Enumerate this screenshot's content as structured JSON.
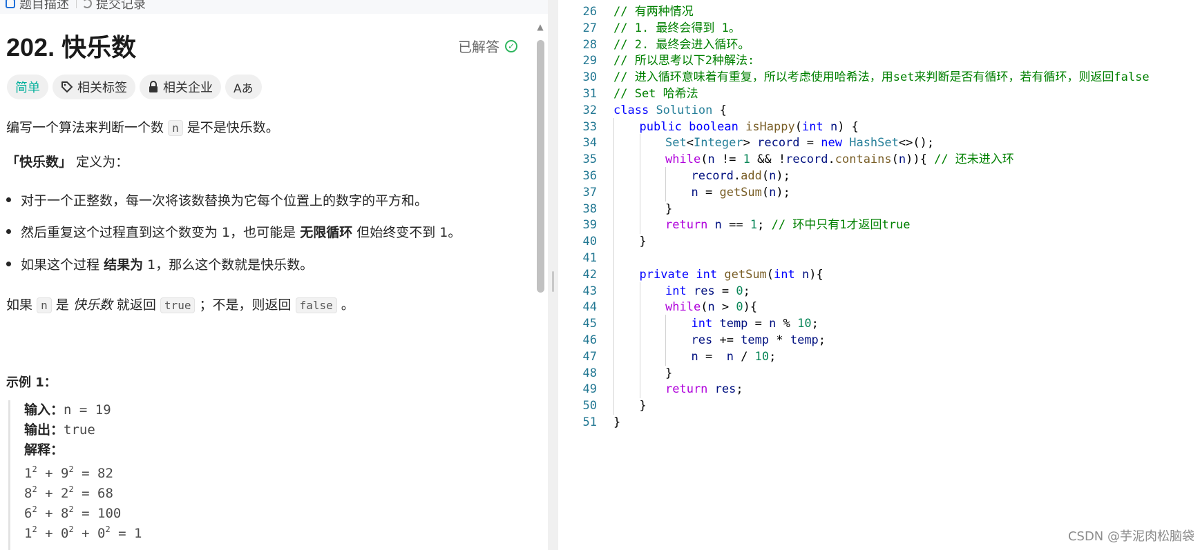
{
  "tabs": {
    "description": "题目描述",
    "submissions": "提交记录"
  },
  "problem": {
    "title": "202. 快乐数",
    "status": "已解答",
    "tags": {
      "difficulty": "简单",
      "topics": "相关标签",
      "companies": "相关企业",
      "translate_glyph": "Aあ"
    },
    "desc": {
      "p1_a": "编写一个算法来判断一个数",
      "p1_code": "n",
      "p1_b": "是不是快乐数。",
      "p2_bold": "「快乐数」",
      "p2_rest": "定义为：",
      "b1": "对于一个正整数，每一次将该数替换为它每个位置上的数字的平方和。",
      "b2_a": "然后重复这个过程直到这个数变为 1，也可能是",
      "b2_bold": "无限循环",
      "b2_b": "但始终变不到 1。",
      "b3_a": "如果这个过程",
      "b3_bold": "结果为",
      "b3_b": "1，那么这个数就是快乐数。",
      "p3_a": "如果",
      "p3_code1": "n",
      "p3_b": "是",
      "p3_em": "快乐数",
      "p3_c": "就返回",
      "p3_code2": "true",
      "p3_d": "；不是，则返回",
      "p3_code3": "false",
      "p3_e": "。"
    },
    "example": {
      "title": "示例 1：",
      "input_label": "输入：",
      "input_value": "n = 19",
      "output_label": "输出：",
      "output_value": "true",
      "explain_label": "解释：",
      "lines": [
        {
          "t1": "1",
          "t2": "9",
          "rest": " = 82"
        },
        {
          "t1": "8",
          "t2": "2",
          "rest": " = 68"
        },
        {
          "t1": "6",
          "t2": "8",
          "rest": " = 100"
        }
      ],
      "last": {
        "t1": "1",
        "t2": "0",
        "t3": "0",
        "rest": " = 1"
      },
      "exp": "2",
      "plus": " + "
    }
  },
  "code": {
    "lines": [
      {
        "n": "26",
        "indent": 0,
        "tokens": [
          [
            "cm",
            "// 有两种情况"
          ]
        ]
      },
      {
        "n": "27",
        "indent": 0,
        "tokens": [
          [
            "cm",
            "// 1. 最终会得到 1。"
          ]
        ]
      },
      {
        "n": "28",
        "indent": 0,
        "tokens": [
          [
            "cm",
            "// 2. 最终会进入循环。"
          ]
        ]
      },
      {
        "n": "29",
        "indent": 0,
        "tokens": [
          [
            "cm",
            "// 所以思考以下2种解法:"
          ]
        ]
      },
      {
        "n": "30",
        "indent": 0,
        "tokens": [
          [
            "cm",
            "// 进入循环意味着有重复，所以考虑使用哈希法，用set来判断是否有循环，若有循环，则返回false"
          ]
        ]
      },
      {
        "n": "31",
        "indent": 0,
        "tokens": [
          [
            "cm",
            "// Set 哈希法"
          ]
        ]
      },
      {
        "n": "32",
        "indent": 0,
        "tokens": [
          [
            "kw",
            "class"
          ],
          [
            "pl",
            " "
          ],
          [
            "ty",
            "Solution"
          ],
          [
            "pl",
            " {"
          ]
        ]
      },
      {
        "n": "33",
        "indent": 1,
        "tokens": [
          [
            "kw",
            "public"
          ],
          [
            "pl",
            " "
          ],
          [
            "kw",
            "boolean"
          ],
          [
            "pl",
            " "
          ],
          [
            "fn",
            "isHappy"
          ],
          [
            "pl",
            "("
          ],
          [
            "kw",
            "int"
          ],
          [
            "pl",
            " "
          ],
          [
            "vr",
            "n"
          ],
          [
            "pl",
            ") {"
          ]
        ]
      },
      {
        "n": "34",
        "indent": 2,
        "tokens": [
          [
            "ty",
            "Set"
          ],
          [
            "pl",
            "<"
          ],
          [
            "ty",
            "Integer"
          ],
          [
            "pl",
            "> "
          ],
          [
            "vr",
            "record"
          ],
          [
            "pl",
            " = "
          ],
          [
            "kw",
            "new"
          ],
          [
            "pl",
            " "
          ],
          [
            "ty",
            "HashSet"
          ],
          [
            "pl",
            "<>();"
          ]
        ]
      },
      {
        "n": "35",
        "indent": 2,
        "tokens": [
          [
            "kw2",
            "while"
          ],
          [
            "pl",
            "("
          ],
          [
            "vr",
            "n"
          ],
          [
            "pl",
            " != "
          ],
          [
            "nm",
            "1"
          ],
          [
            "pl",
            " && !"
          ],
          [
            "vr",
            "record"
          ],
          [
            "pl",
            "."
          ],
          [
            "fn",
            "contains"
          ],
          [
            "pl",
            "("
          ],
          [
            "vr",
            "n"
          ],
          [
            "pl",
            ")){ "
          ],
          [
            "cm",
            "// 还未进入环"
          ]
        ]
      },
      {
        "n": "36",
        "indent": 3,
        "tokens": [
          [
            "vr",
            "record"
          ],
          [
            "pl",
            "."
          ],
          [
            "fn",
            "add"
          ],
          [
            "pl",
            "("
          ],
          [
            "vr",
            "n"
          ],
          [
            "pl",
            ");"
          ]
        ]
      },
      {
        "n": "37",
        "indent": 3,
        "tokens": [
          [
            "vr",
            "n"
          ],
          [
            "pl",
            " = "
          ],
          [
            "fn",
            "getSum"
          ],
          [
            "pl",
            "("
          ],
          [
            "vr",
            "n"
          ],
          [
            "pl",
            ");"
          ]
        ]
      },
      {
        "n": "38",
        "indent": 2,
        "tokens": [
          [
            "pl",
            "}"
          ]
        ]
      },
      {
        "n": "39",
        "indent": 2,
        "tokens": [
          [
            "kw2",
            "return"
          ],
          [
            "pl",
            " "
          ],
          [
            "vr",
            "n"
          ],
          [
            "pl",
            " == "
          ],
          [
            "nm",
            "1"
          ],
          [
            "pl",
            "; "
          ],
          [
            "cm",
            "// 环中只有1才返回true"
          ]
        ]
      },
      {
        "n": "40",
        "indent": 1,
        "tokens": [
          [
            "pl",
            "}"
          ]
        ]
      },
      {
        "n": "41",
        "indent": 1,
        "tokens": []
      },
      {
        "n": "42",
        "indent": 1,
        "tokens": [
          [
            "kw",
            "private"
          ],
          [
            "pl",
            " "
          ],
          [
            "kw",
            "int"
          ],
          [
            "pl",
            " "
          ],
          [
            "fn",
            "getSum"
          ],
          [
            "pl",
            "("
          ],
          [
            "kw",
            "int"
          ],
          [
            "pl",
            " "
          ],
          [
            "vr",
            "n"
          ],
          [
            "pl",
            "){"
          ]
        ]
      },
      {
        "n": "43",
        "indent": 2,
        "tokens": [
          [
            "kw",
            "int"
          ],
          [
            "pl",
            " "
          ],
          [
            "vr",
            "res"
          ],
          [
            "pl",
            " = "
          ],
          [
            "nm",
            "0"
          ],
          [
            "pl",
            ";"
          ]
        ]
      },
      {
        "n": "44",
        "indent": 2,
        "tokens": [
          [
            "kw2",
            "while"
          ],
          [
            "pl",
            "("
          ],
          [
            "vr",
            "n"
          ],
          [
            "pl",
            " > "
          ],
          [
            "nm",
            "0"
          ],
          [
            "pl",
            "){"
          ]
        ]
      },
      {
        "n": "45",
        "indent": 3,
        "tokens": [
          [
            "kw",
            "int"
          ],
          [
            "pl",
            " "
          ],
          [
            "vr",
            "temp"
          ],
          [
            "pl",
            " = "
          ],
          [
            "vr",
            "n"
          ],
          [
            "pl",
            " % "
          ],
          [
            "nm",
            "10"
          ],
          [
            "pl",
            ";"
          ]
        ]
      },
      {
        "n": "46",
        "indent": 3,
        "tokens": [
          [
            "vr",
            "res"
          ],
          [
            "pl",
            " += "
          ],
          [
            "vr",
            "temp"
          ],
          [
            "pl",
            " * "
          ],
          [
            "vr",
            "temp"
          ],
          [
            "pl",
            ";"
          ]
        ]
      },
      {
        "n": "47",
        "indent": 3,
        "tokens": [
          [
            "vr",
            "n"
          ],
          [
            "pl",
            " =  "
          ],
          [
            "vr",
            "n"
          ],
          [
            "pl",
            " / "
          ],
          [
            "nm",
            "10"
          ],
          [
            "pl",
            ";"
          ]
        ]
      },
      {
        "n": "48",
        "indent": 2,
        "tokens": [
          [
            "pl",
            "}"
          ]
        ]
      },
      {
        "n": "49",
        "indent": 2,
        "tokens": [
          [
            "kw2",
            "return"
          ],
          [
            "pl",
            " "
          ],
          [
            "vr",
            "res"
          ],
          [
            "pl",
            ";"
          ]
        ]
      },
      {
        "n": "50",
        "indent": 1,
        "tokens": [
          [
            "pl",
            "}"
          ]
        ]
      },
      {
        "n": "51",
        "indent": 0,
        "tokens": [
          [
            "pl",
            "}"
          ]
        ]
      }
    ]
  },
  "watermark": "CSDN @芋泥肉松脑袋"
}
